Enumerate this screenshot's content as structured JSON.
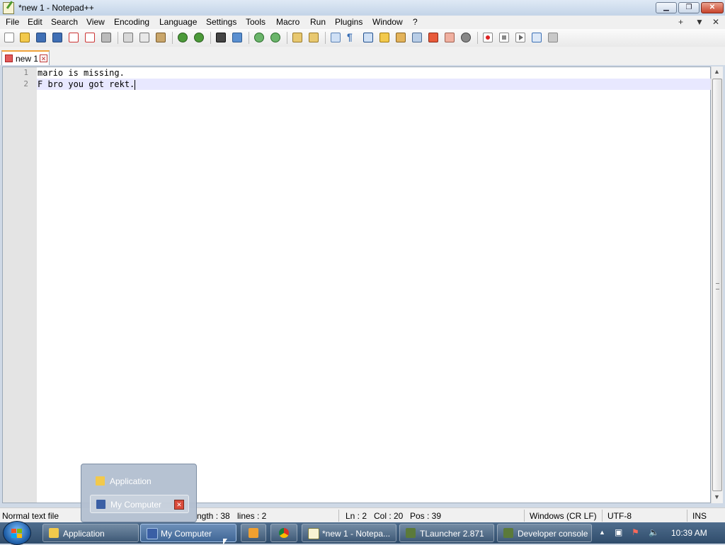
{
  "window": {
    "title": "*new 1 - Notepad++",
    "minimize_icon": "minimize-icon",
    "maximize_icon": "restore-icon",
    "close_icon": "close-icon"
  },
  "menu": {
    "items": [
      "File",
      "Edit",
      "Search",
      "View",
      "Encoding",
      "Language",
      "Settings",
      "Tools",
      "Macro",
      "Run",
      "Plugins",
      "Window",
      "?"
    ],
    "right": [
      "+",
      "▼",
      "✕"
    ]
  },
  "toolbar": {
    "icons": [
      "new-file-icon",
      "open-file-icon",
      "save-icon",
      "save-all-icon",
      "close-icon",
      "close-all-icon",
      "print-icon",
      "cut-icon",
      "copy-icon",
      "paste-icon",
      "undo-icon",
      "redo-icon",
      "find-icon",
      "replace-icon",
      "zoom-in-icon",
      "zoom-out-icon",
      "sync-vertical-icon",
      "sync-horizontal-icon",
      "word-wrap-icon",
      "show-all-chars-icon",
      "indent-guide-icon",
      "language-icon",
      "doc-map-icon",
      "function-list-icon",
      "folder-workspace-icon",
      "monitor-icon",
      "record-macro-icon",
      "stop-record-icon",
      "play-macro-icon",
      "run-macro-multiple-icon",
      "save-macro-icon"
    ]
  },
  "tabs": [
    {
      "label": "new 1",
      "icon": "unsaved-file-icon",
      "close_icon": "tab-close-icon"
    }
  ],
  "editor": {
    "lines": [
      {
        "number": "1",
        "text": "mario is missing."
      },
      {
        "number": "2",
        "text": "F bro you got rekt."
      }
    ],
    "current_line": 2,
    "current_line_color": "#e8e8ff"
  },
  "status": {
    "type": "Normal text file",
    "length": "ngth : 38",
    "lines": "lines : 2",
    "ln": "Ln : 2",
    "col": "Col : 20",
    "pos": "Pos : 39",
    "eol": "Windows (CR LF)",
    "encoding": "UTF-8",
    "mode": "INS"
  },
  "taskbar": {
    "buttons": [
      {
        "label": "Application",
        "icon": "folder-icon"
      },
      {
        "label": "My Computer",
        "icon": "computer-icon",
        "active": true
      },
      {
        "label": "",
        "icon": "media-player-icon"
      },
      {
        "label": "",
        "icon": "chrome-icon"
      },
      {
        "label": "*new 1 - Notepa...",
        "icon": "notepad-icon"
      },
      {
        "label": "TLauncher 2.871",
        "icon": "minecraft-icon"
      },
      {
        "label": "Developer console",
        "icon": "minecraft-icon"
      }
    ],
    "tray_icons": [
      "show-hidden-icons-icon",
      "network-icon",
      "flag-alert-icon",
      "volume-icon"
    ],
    "clock": "10:39 AM"
  },
  "popup": {
    "items": [
      {
        "label": "Application",
        "icon": "folder-icon"
      },
      {
        "label": "My Computer",
        "icon": "computer-icon",
        "close_icon": "close-icon"
      }
    ]
  }
}
